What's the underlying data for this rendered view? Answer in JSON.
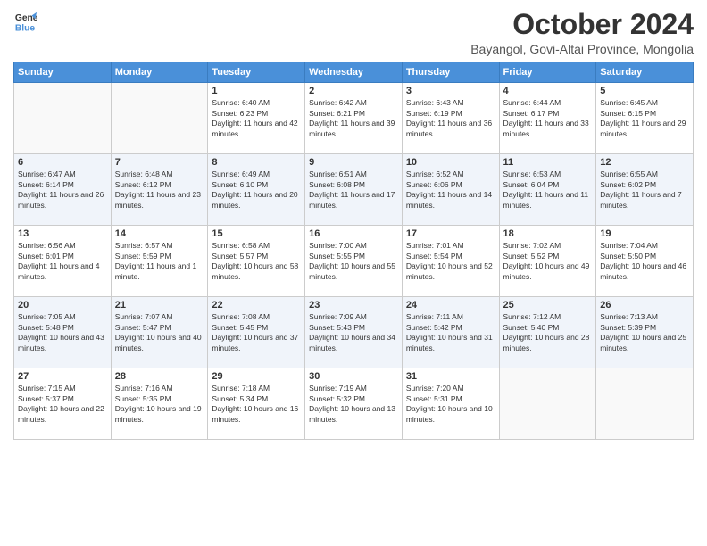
{
  "logo": {
    "line1": "General",
    "line2": "Blue"
  },
  "header": {
    "month": "October 2024",
    "location": "Bayangol, Govi-Altai Province, Mongolia"
  },
  "days_of_week": [
    "Sunday",
    "Monday",
    "Tuesday",
    "Wednesday",
    "Thursday",
    "Friday",
    "Saturday"
  ],
  "weeks": [
    [
      {
        "day": "",
        "sunrise": "",
        "sunset": "",
        "daylight": ""
      },
      {
        "day": "",
        "sunrise": "",
        "sunset": "",
        "daylight": ""
      },
      {
        "day": "1",
        "sunrise": "Sunrise: 6:40 AM",
        "sunset": "Sunset: 6:23 PM",
        "daylight": "Daylight: 11 hours and 42 minutes."
      },
      {
        "day": "2",
        "sunrise": "Sunrise: 6:42 AM",
        "sunset": "Sunset: 6:21 PM",
        "daylight": "Daylight: 11 hours and 39 minutes."
      },
      {
        "day": "3",
        "sunrise": "Sunrise: 6:43 AM",
        "sunset": "Sunset: 6:19 PM",
        "daylight": "Daylight: 11 hours and 36 minutes."
      },
      {
        "day": "4",
        "sunrise": "Sunrise: 6:44 AM",
        "sunset": "Sunset: 6:17 PM",
        "daylight": "Daylight: 11 hours and 33 minutes."
      },
      {
        "day": "5",
        "sunrise": "Sunrise: 6:45 AM",
        "sunset": "Sunset: 6:15 PM",
        "daylight": "Daylight: 11 hours and 29 minutes."
      }
    ],
    [
      {
        "day": "6",
        "sunrise": "Sunrise: 6:47 AM",
        "sunset": "Sunset: 6:14 PM",
        "daylight": "Daylight: 11 hours and 26 minutes."
      },
      {
        "day": "7",
        "sunrise": "Sunrise: 6:48 AM",
        "sunset": "Sunset: 6:12 PM",
        "daylight": "Daylight: 11 hours and 23 minutes."
      },
      {
        "day": "8",
        "sunrise": "Sunrise: 6:49 AM",
        "sunset": "Sunset: 6:10 PM",
        "daylight": "Daylight: 11 hours and 20 minutes."
      },
      {
        "day": "9",
        "sunrise": "Sunrise: 6:51 AM",
        "sunset": "Sunset: 6:08 PM",
        "daylight": "Daylight: 11 hours and 17 minutes."
      },
      {
        "day": "10",
        "sunrise": "Sunrise: 6:52 AM",
        "sunset": "Sunset: 6:06 PM",
        "daylight": "Daylight: 11 hours and 14 minutes."
      },
      {
        "day": "11",
        "sunrise": "Sunrise: 6:53 AM",
        "sunset": "Sunset: 6:04 PM",
        "daylight": "Daylight: 11 hours and 11 minutes."
      },
      {
        "day": "12",
        "sunrise": "Sunrise: 6:55 AM",
        "sunset": "Sunset: 6:02 PM",
        "daylight": "Daylight: 11 hours and 7 minutes."
      }
    ],
    [
      {
        "day": "13",
        "sunrise": "Sunrise: 6:56 AM",
        "sunset": "Sunset: 6:01 PM",
        "daylight": "Daylight: 11 hours and 4 minutes."
      },
      {
        "day": "14",
        "sunrise": "Sunrise: 6:57 AM",
        "sunset": "Sunset: 5:59 PM",
        "daylight": "Daylight: 11 hours and 1 minute."
      },
      {
        "day": "15",
        "sunrise": "Sunrise: 6:58 AM",
        "sunset": "Sunset: 5:57 PM",
        "daylight": "Daylight: 10 hours and 58 minutes."
      },
      {
        "day": "16",
        "sunrise": "Sunrise: 7:00 AM",
        "sunset": "Sunset: 5:55 PM",
        "daylight": "Daylight: 10 hours and 55 minutes."
      },
      {
        "day": "17",
        "sunrise": "Sunrise: 7:01 AM",
        "sunset": "Sunset: 5:54 PM",
        "daylight": "Daylight: 10 hours and 52 minutes."
      },
      {
        "day": "18",
        "sunrise": "Sunrise: 7:02 AM",
        "sunset": "Sunset: 5:52 PM",
        "daylight": "Daylight: 10 hours and 49 minutes."
      },
      {
        "day": "19",
        "sunrise": "Sunrise: 7:04 AM",
        "sunset": "Sunset: 5:50 PM",
        "daylight": "Daylight: 10 hours and 46 minutes."
      }
    ],
    [
      {
        "day": "20",
        "sunrise": "Sunrise: 7:05 AM",
        "sunset": "Sunset: 5:48 PM",
        "daylight": "Daylight: 10 hours and 43 minutes."
      },
      {
        "day": "21",
        "sunrise": "Sunrise: 7:07 AM",
        "sunset": "Sunset: 5:47 PM",
        "daylight": "Daylight: 10 hours and 40 minutes."
      },
      {
        "day": "22",
        "sunrise": "Sunrise: 7:08 AM",
        "sunset": "Sunset: 5:45 PM",
        "daylight": "Daylight: 10 hours and 37 minutes."
      },
      {
        "day": "23",
        "sunrise": "Sunrise: 7:09 AM",
        "sunset": "Sunset: 5:43 PM",
        "daylight": "Daylight: 10 hours and 34 minutes."
      },
      {
        "day": "24",
        "sunrise": "Sunrise: 7:11 AM",
        "sunset": "Sunset: 5:42 PM",
        "daylight": "Daylight: 10 hours and 31 minutes."
      },
      {
        "day": "25",
        "sunrise": "Sunrise: 7:12 AM",
        "sunset": "Sunset: 5:40 PM",
        "daylight": "Daylight: 10 hours and 28 minutes."
      },
      {
        "day": "26",
        "sunrise": "Sunrise: 7:13 AM",
        "sunset": "Sunset: 5:39 PM",
        "daylight": "Daylight: 10 hours and 25 minutes."
      }
    ],
    [
      {
        "day": "27",
        "sunrise": "Sunrise: 7:15 AM",
        "sunset": "Sunset: 5:37 PM",
        "daylight": "Daylight: 10 hours and 22 minutes."
      },
      {
        "day": "28",
        "sunrise": "Sunrise: 7:16 AM",
        "sunset": "Sunset: 5:35 PM",
        "daylight": "Daylight: 10 hours and 19 minutes."
      },
      {
        "day": "29",
        "sunrise": "Sunrise: 7:18 AM",
        "sunset": "Sunset: 5:34 PM",
        "daylight": "Daylight: 10 hours and 16 minutes."
      },
      {
        "day": "30",
        "sunrise": "Sunrise: 7:19 AM",
        "sunset": "Sunset: 5:32 PM",
        "daylight": "Daylight: 10 hours and 13 minutes."
      },
      {
        "day": "31",
        "sunrise": "Sunrise: 7:20 AM",
        "sunset": "Sunset: 5:31 PM",
        "daylight": "Daylight: 10 hours and 10 minutes."
      },
      {
        "day": "",
        "sunrise": "",
        "sunset": "",
        "daylight": ""
      },
      {
        "day": "",
        "sunrise": "",
        "sunset": "",
        "daylight": ""
      }
    ]
  ]
}
